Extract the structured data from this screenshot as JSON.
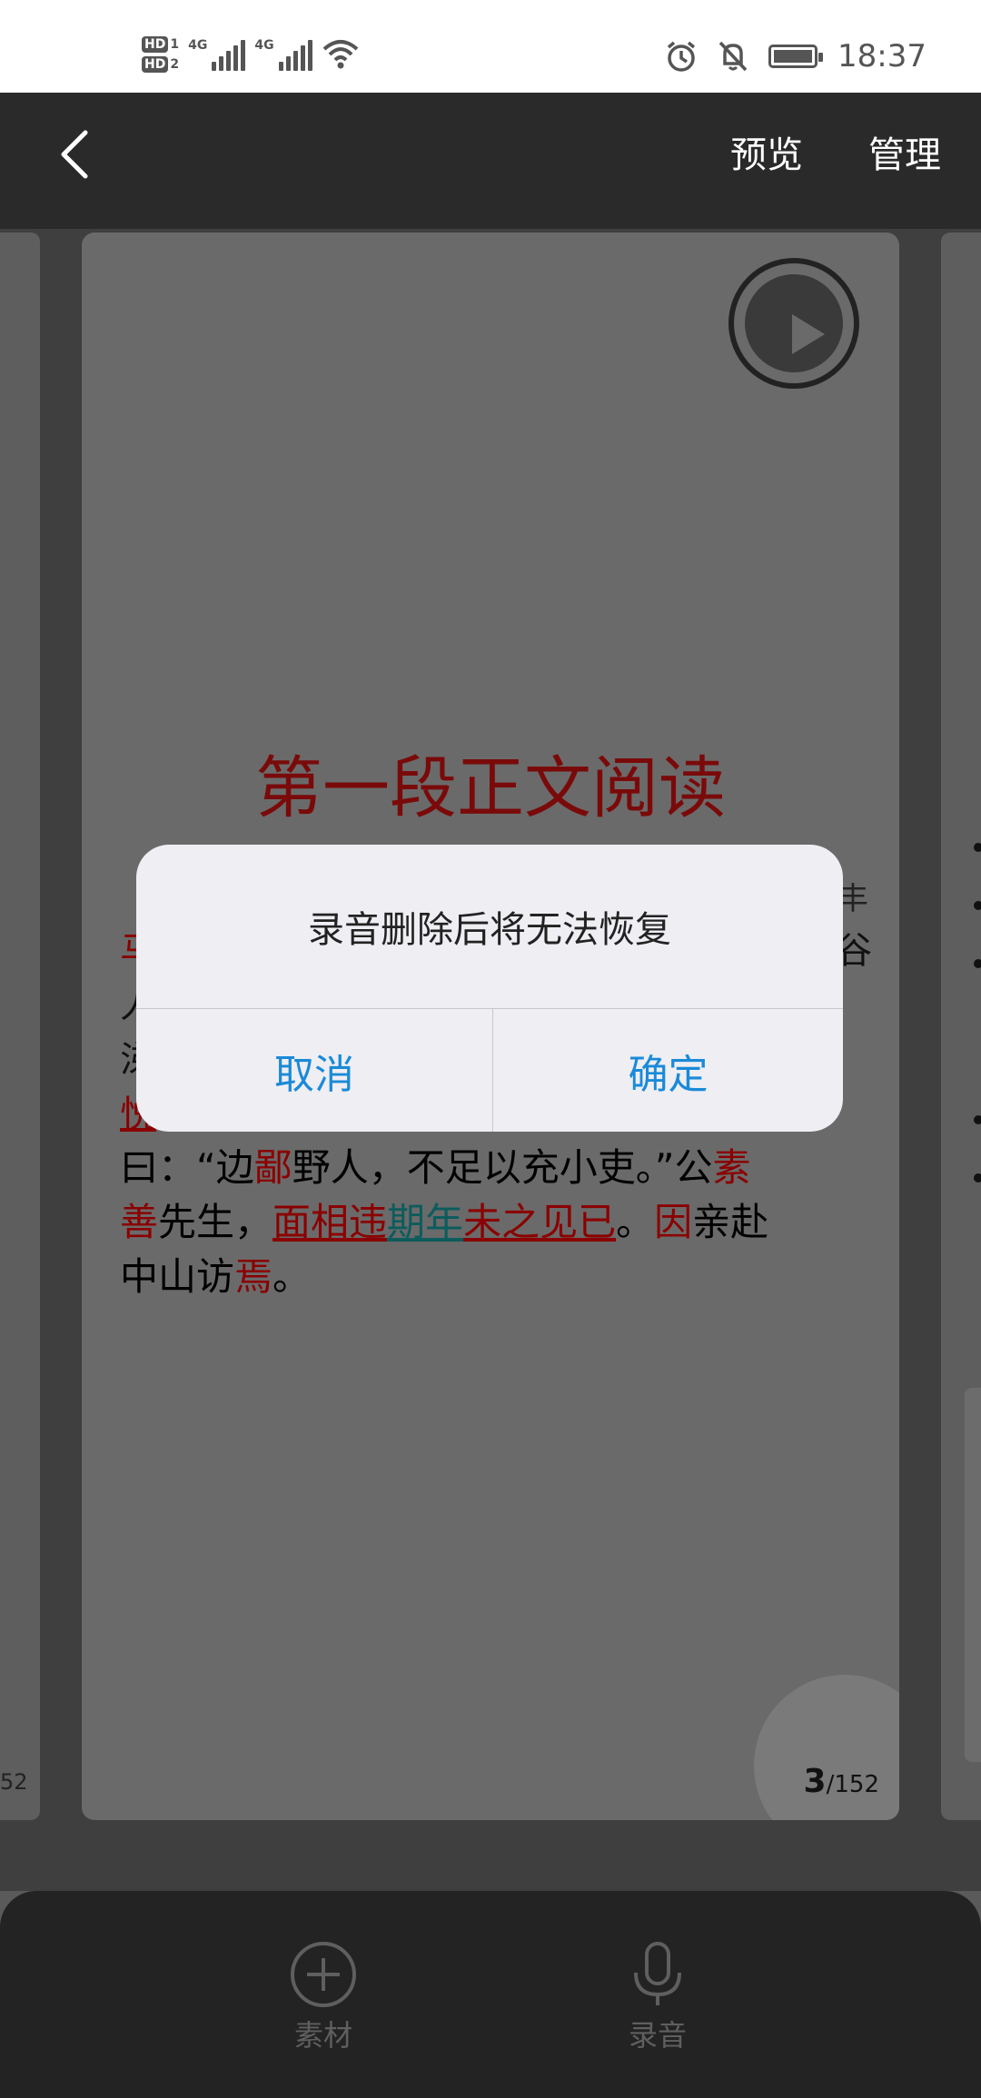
{
  "status_bar": {
    "hd1": "HD",
    "hd1_sub": "1",
    "hd2": "HD",
    "hd2_sub": "2",
    "net1": "4G",
    "net2": "4G",
    "time": "18:37",
    "icons": [
      "hd-icon",
      "signal-icon",
      "wifi-icon",
      "alarm-icon",
      "bell-off-icon",
      "battery-icon"
    ]
  },
  "nav": {
    "back_icon": "chevron-left-icon",
    "preview_label": "预览",
    "manage_label": "管理"
  },
  "card": {
    "title": "第一段正文阅读",
    "partial_right_char": "丰",
    "left_partials": [
      "马",
      "人",
      "涕",
      "悦"
    ],
    "right_partial": "谷",
    "page_current": "3",
    "page_total": "/152",
    "side_page_total": "52",
    "body": {
      "l1_a": "曰：“边",
      "l1_b": "鄙",
      "l1_c": "野人，不足以充小吏。”公",
      "l1_d": "素",
      "l2_a": "善",
      "l2_b": "先生，",
      "l2_c": "面相违",
      "l2_d": "期年",
      "l2_e": "未之见已",
      "l2_f": "。",
      "l2_g": "因",
      "l2_h": "亲赴",
      "l3_a": "中山访",
      "l3_b": "焉",
      "l3_c": "。"
    }
  },
  "dialog": {
    "message": "录音删除后将无法恢复",
    "cancel_label": "取消",
    "confirm_label": "确定"
  },
  "bottom_bar": {
    "material_label": "素材",
    "record_label": "录音",
    "material_icon": "plus-circle-icon",
    "record_icon": "microphone-icon"
  },
  "colors": {
    "accent_blue": "#1a8ad8",
    "title_red": "#7a0a0a",
    "text_red": "#8a0000",
    "text_teal": "#0d5c5c"
  }
}
